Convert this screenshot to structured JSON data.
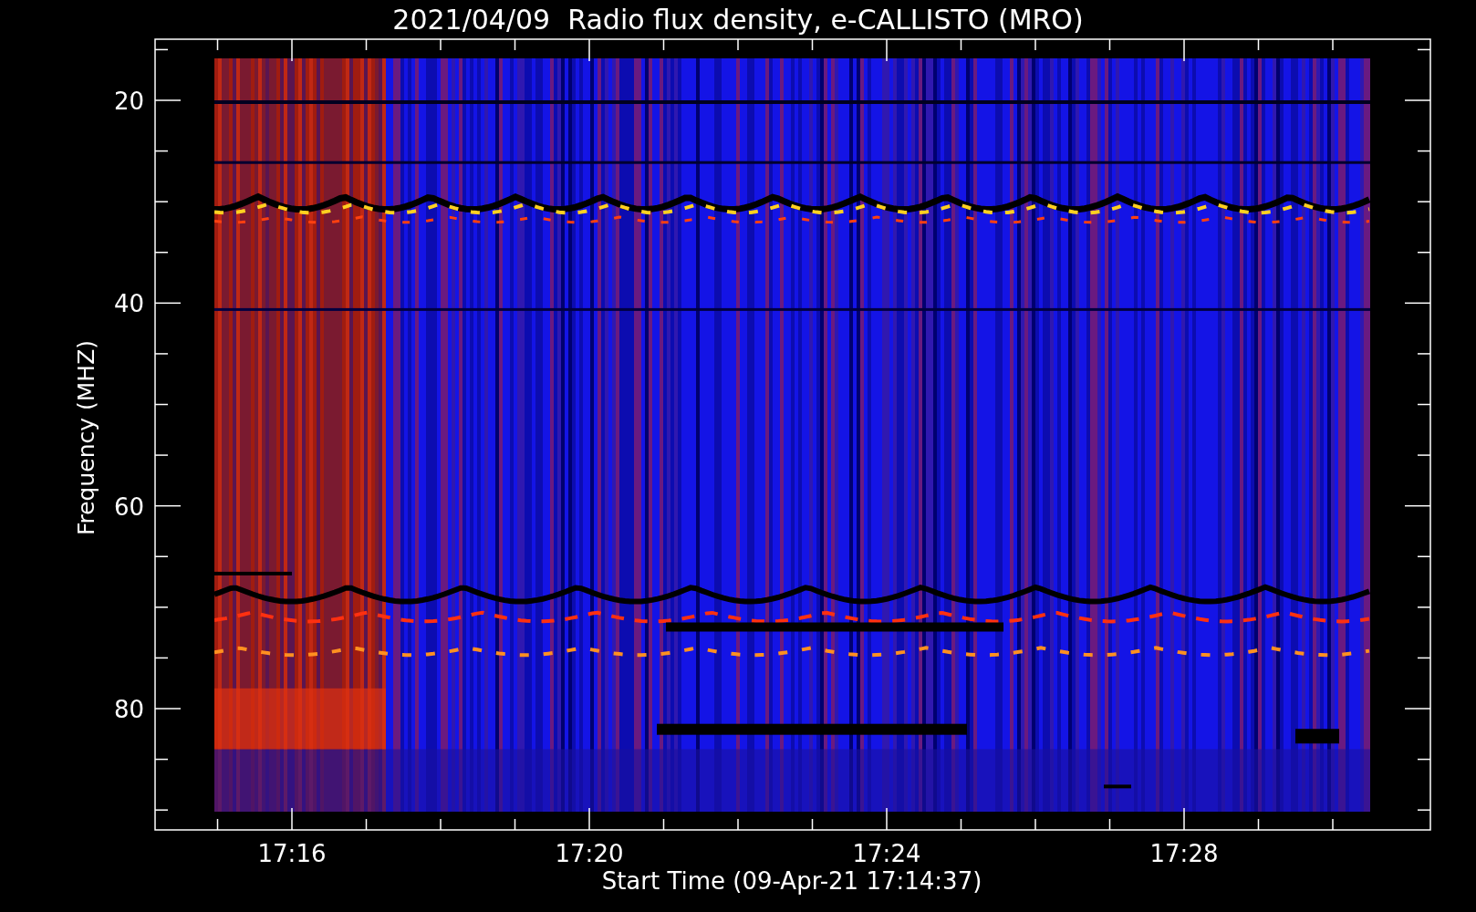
{
  "title": "2021/04/09  Radio flux density, e-CALLISTO (MRO)",
  "y_axis": {
    "label": "Frequency (MHZ)",
    "ticks": [
      "20",
      "40",
      "60",
      "80"
    ]
  },
  "x_axis": {
    "label": "Start Time (09-Apr-21 17:14:37)",
    "ticks": [
      "17:16",
      "17:20",
      "17:24",
      "17:28"
    ]
  }
}
